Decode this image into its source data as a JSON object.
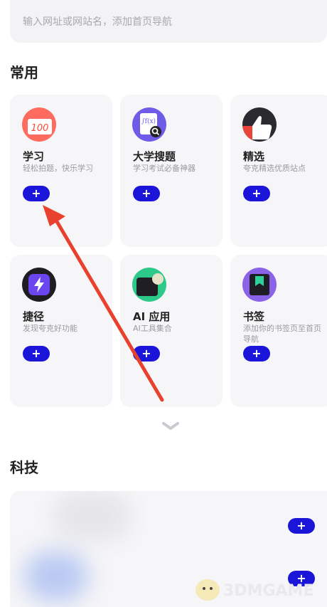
{
  "search": {
    "placeholder": "输入网址或网站名，添加首页导航"
  },
  "sections": {
    "common": "常用",
    "tech": "科技"
  },
  "cards": [
    {
      "title": "学习",
      "subtitle": "轻松拍题，快乐学习",
      "icon": "study-100-icon",
      "color": "#ff6b5e"
    },
    {
      "title": "大学搜题",
      "subtitle": "学习考试必备神器",
      "icon": "formula-search-icon",
      "color": "#6e5ce8"
    },
    {
      "title": "精选",
      "subtitle": "夸克精选优质站点",
      "icon": "thumbs-up-icon",
      "color": "#2a2a30"
    },
    {
      "title": "捷径",
      "subtitle": "发现夸克好功能",
      "icon": "lightning-icon",
      "color": "#6b46f0"
    },
    {
      "title": "AI 应用",
      "subtitle": "AI工具集合",
      "icon": "ai-app-icon",
      "color": "#2dc98a"
    },
    {
      "title": "书签",
      "subtitle": "添加你的书签页至首页导航",
      "icon": "bookmark-icon",
      "color": "#8a63e8"
    }
  ],
  "add_symbol": "+",
  "watermark": {
    "text": "3DMGAME"
  },
  "colors": {
    "accent": "#1a15d8",
    "arrow": "#e8412e",
    "card_bg": "#f6f6f8"
  }
}
